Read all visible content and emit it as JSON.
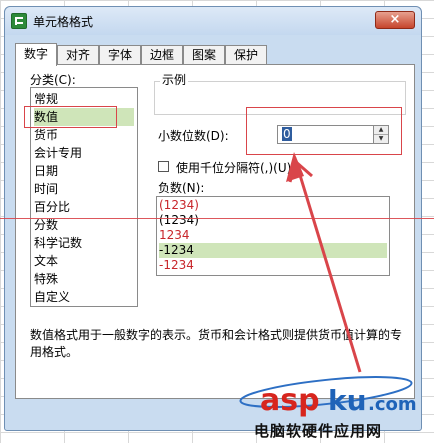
{
  "window": {
    "title": "单元格格式",
    "close_label": "×"
  },
  "tabs": [
    {
      "label": "数字",
      "active": true
    },
    {
      "label": "对齐"
    },
    {
      "label": "字体"
    },
    {
      "label": "边框"
    },
    {
      "label": "图案"
    },
    {
      "label": "保护"
    }
  ],
  "category": {
    "label": "分类(C):",
    "items": [
      "常规",
      "数值",
      "货币",
      "会计专用",
      "日期",
      "时间",
      "百分比",
      "分数",
      "科学记数",
      "文本",
      "特殊",
      "自定义"
    ],
    "selected": "数值"
  },
  "sample": {
    "label": "示例",
    "value": ""
  },
  "decimal": {
    "label": "小数位数(D):",
    "value": "0"
  },
  "thousands": {
    "label": "使用千位分隔符(,)(U)",
    "checked": false
  },
  "negative": {
    "label": "负数(N):",
    "items": [
      {
        "text": "(1234)",
        "color": "#c8262b"
      },
      {
        "text": "(1234)",
        "color": "#000000"
      },
      {
        "text": "1234",
        "color": "#c8262b"
      },
      {
        "text": "-1234",
        "color": "#000000"
      },
      {
        "text": "-1234",
        "color": "#c8262b"
      }
    ],
    "selected_index": 3
  },
  "description": "数值格式用于一般数字的表示。货币和会计格式则提供货币值计算的专用格式。",
  "watermark": {
    "logo": "aspku.com",
    "subtitle": "电脑软硬件应用网"
  },
  "colors": {
    "accent_red": "#d9454a",
    "selection_green": "#cfe5b9",
    "dialog_blue": "#c9dcf0"
  }
}
